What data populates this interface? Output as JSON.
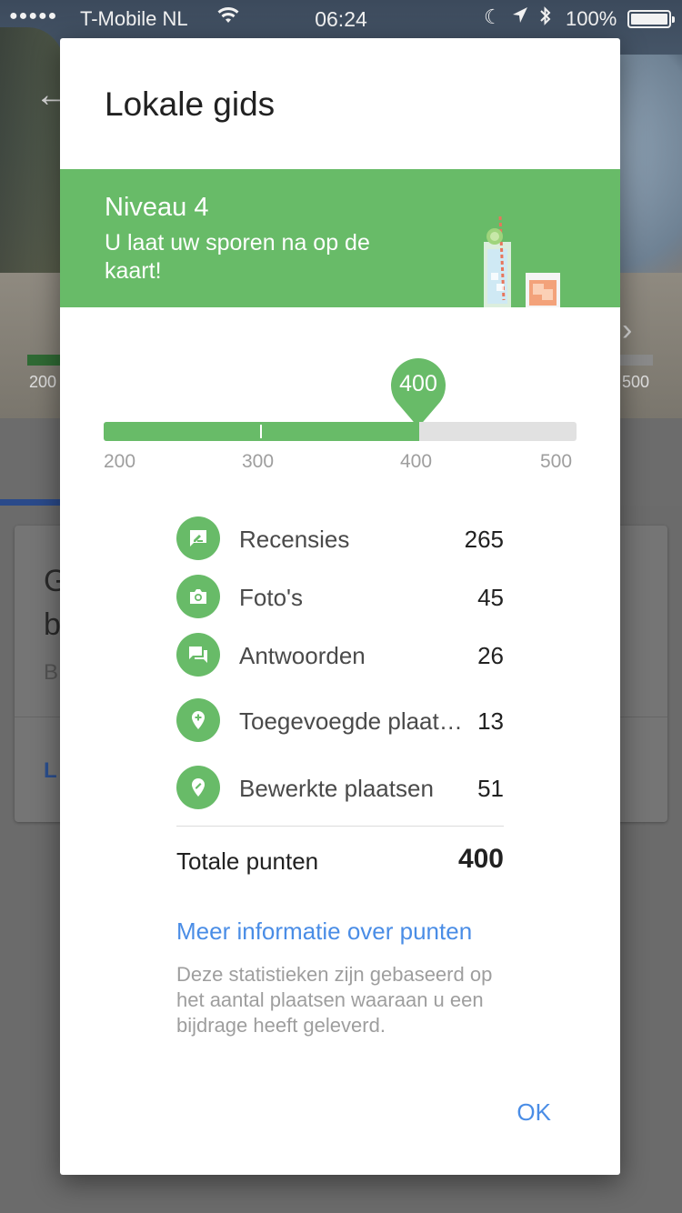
{
  "status_bar": {
    "signal": "●●●●●",
    "carrier": "T-Mobile NL",
    "time": "06:24",
    "battery": "100%"
  },
  "background": {
    "progress_left": "200",
    "progress_right": "500",
    "card_line1": "G",
    "card_line2": "b",
    "card_line3": "B",
    "card_action": "L"
  },
  "dialog": {
    "title": "Lokale gids",
    "banner": {
      "level": "Niveau 4",
      "subtitle": "U laat uw sporen na op de kaart!"
    },
    "progress": {
      "points": 400,
      "pin_label": "400",
      "min": 200,
      "max": 500,
      "scale": [
        "200",
        "300",
        "400",
        "500"
      ]
    },
    "stats": [
      {
        "label": "Recensies",
        "value": "265",
        "icon": "review-icon"
      },
      {
        "label": "Foto's",
        "value": "45",
        "icon": "camera-icon"
      },
      {
        "label": "Antwoorden",
        "value": "26",
        "icon": "answers-icon"
      },
      {
        "label": "Toegevoegde plaatsen",
        "value": "13",
        "icon": "add-place-icon"
      },
      {
        "label": "Bewerkte plaatsen",
        "value": "51",
        "icon": "edit-place-icon"
      }
    ],
    "total_label": "Totale punten",
    "total_value": "400",
    "more_link": "Meer informatie over punten",
    "note": "Deze statistieken zijn gebaseerd op het aantal plaatsen waaraan u een bijdrage heeft geleverd.",
    "ok_label": "OK"
  },
  "colors": {
    "accent_green": "#68bb68",
    "link_blue": "#4a8de6",
    "track_grey": "#e1e1e1"
  }
}
